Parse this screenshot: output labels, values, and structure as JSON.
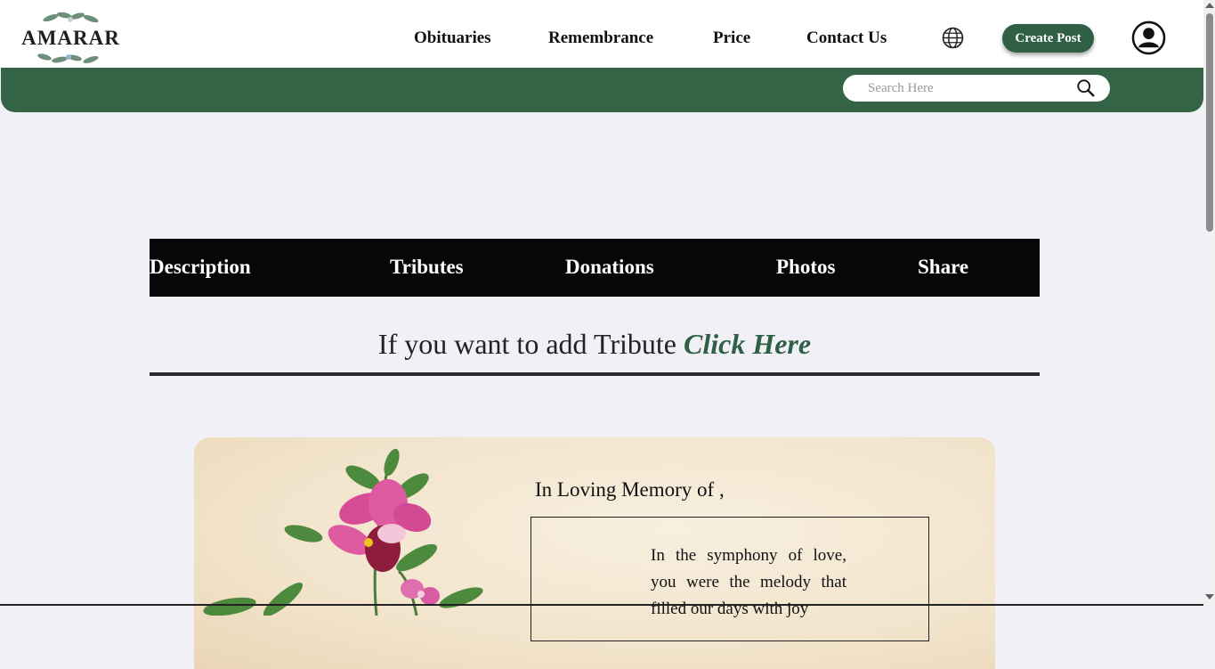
{
  "header": {
    "logo_text": "AMARAR",
    "nav": [
      "Obituaries",
      "Remembrance",
      "Price",
      "Contact Us"
    ],
    "globe_icon": "globe-icon",
    "create_post_label": "Create Post",
    "avatar_icon": "user-avatar-icon"
  },
  "search": {
    "placeholder": "Search Here",
    "icon": "search-icon"
  },
  "tabs": [
    "Description",
    "Tributes",
    "Donations",
    "Photos",
    "Share"
  ],
  "tribute_prompt": {
    "text": "If you want to add Tribute",
    "link": "Click Here"
  },
  "memorial": {
    "heading": "In Loving Memory of ,",
    "poem": "In the symphony of love, you were the melody that filled our days with joy"
  },
  "colors": {
    "brand_green": "#336446",
    "tab_bar": "#070707",
    "page_bg": "#f0f0f6"
  }
}
